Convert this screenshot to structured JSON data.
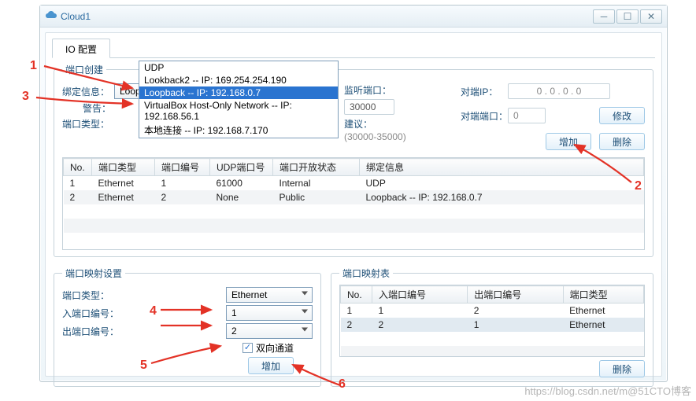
{
  "window": {
    "title": "Cloud1"
  },
  "tab": {
    "label": "IO 配置"
  },
  "annotations": {
    "n1": "1",
    "n2": "2",
    "n3": "3",
    "n4": "4",
    "n5": "5",
    "n6": "6"
  },
  "port_create": {
    "legend": "端口创建",
    "bind_label": "绑定信息：",
    "bind_value": "Loopback -- IP: 192.168.0.7",
    "warn_label": "警告：",
    "type_label": "端口类型：",
    "dropdown": [
      "UDP",
      "Lookback2 -- IP: 169.254.254.190",
      "Loopback -- IP: 192.168.0.7",
      "VirtualBox Host-Only Network -- IP: 192.168.56.1",
      "本地连接 -- IP: 192.168.7.170"
    ],
    "listen_label": "监听端口：",
    "listen_value": "30000",
    "advice_label": "建议：",
    "advice_range": "(30000-35000)",
    "peer_ip_label": "对端IP：",
    "peer_ip_value": "0  .  0  .  0  .  0",
    "peer_port_label": "对端端口：",
    "peer_port_value": "0",
    "modify_btn": "修改",
    "add_btn": "增加",
    "del_btn": "删除",
    "cols": [
      "No.",
      "端口类型",
      "端口编号",
      "UDP端口号",
      "端口开放状态",
      "绑定信息"
    ],
    "rows": [
      [
        "1",
        "Ethernet",
        "1",
        "61000",
        "Internal",
        "UDP"
      ],
      [
        "2",
        "Ethernet",
        "2",
        "None",
        "Public",
        "Loopback -- IP: 192.168.0.7"
      ]
    ]
  },
  "port_map": {
    "legend": "端口映射设置",
    "type_label": "端口类型：",
    "type_value": "Ethernet",
    "in_label": "入端口编号：",
    "in_value": "1",
    "out_label": "出端口编号：",
    "out_value": "2",
    "bidir_label": "双向通道",
    "bidir_checked": true,
    "add_btn": "增加"
  },
  "port_map_table": {
    "legend": "端口映射表",
    "cols": [
      "No.",
      "入端口编号",
      "出端口编号",
      "端口类型"
    ],
    "rows": [
      [
        "1",
        "1",
        "2",
        "Ethernet"
      ],
      [
        "2",
        "2",
        "1",
        "Ethernet"
      ]
    ],
    "del_btn": "删除"
  },
  "watermark": "https://blog.csdn.net/m@51CTO博客"
}
